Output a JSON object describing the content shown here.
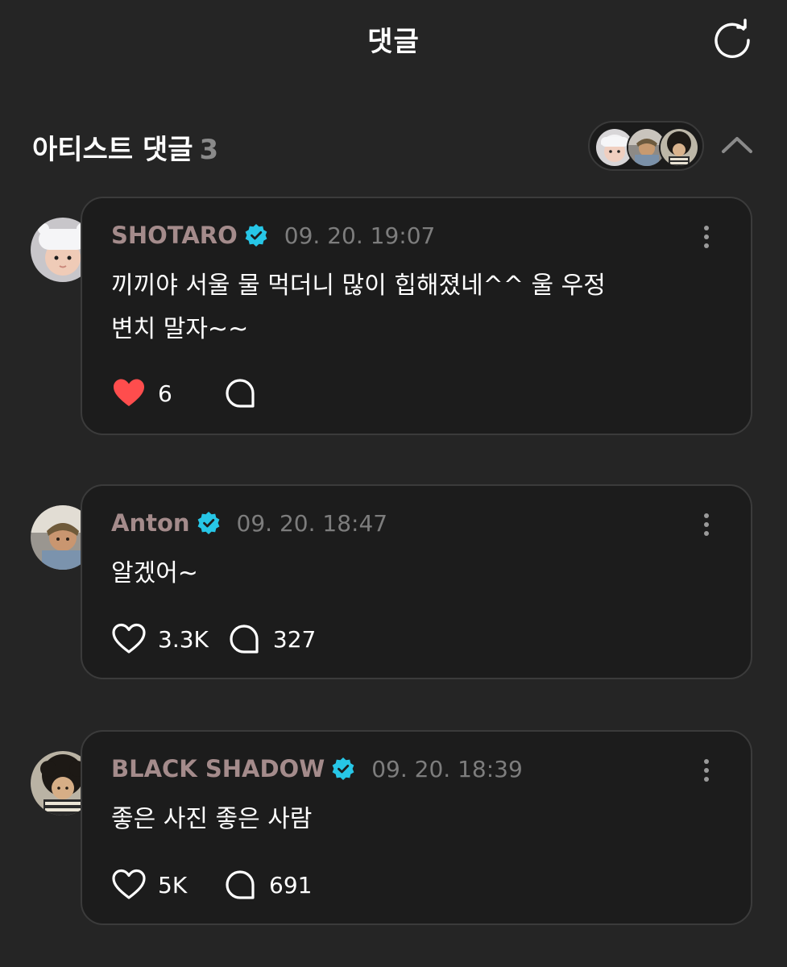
{
  "header": {
    "title": "댓글",
    "refresh_icon": "refresh-icon"
  },
  "section": {
    "title": "아티스트 댓글",
    "count": "3",
    "collapse_icon": "chevron-up-icon"
  },
  "colors": {
    "background": "#252525",
    "card": "#1c1c1c",
    "card_border": "#3b3b3b",
    "author": "#a48b8b",
    "timestamp": "#7d7d7d",
    "verified": "#27c6e6",
    "like_active": "#ff4d4d"
  },
  "comments": [
    {
      "author": "SHOTARO",
      "verified": true,
      "timestamp": "09. 20. 19:07",
      "text_lines": [
        "끼끼야 서울 물 먹더니 많이 힙해졌네^^ 울 우정",
        "변치 말자~~"
      ],
      "likes": "6",
      "liked": true,
      "replies": ""
    },
    {
      "author": "Anton",
      "verified": true,
      "timestamp": "09. 20. 18:47",
      "text_lines": [
        "알겠어~"
      ],
      "likes": "3.3K",
      "liked": false,
      "replies": "327"
    },
    {
      "author": "BLACK SHADOW",
      "verified": true,
      "timestamp": "09. 20. 18:39",
      "text_lines": [
        "좋은 사진 좋은 사람"
      ],
      "likes": "5K",
      "liked": false,
      "replies": "691"
    }
  ]
}
